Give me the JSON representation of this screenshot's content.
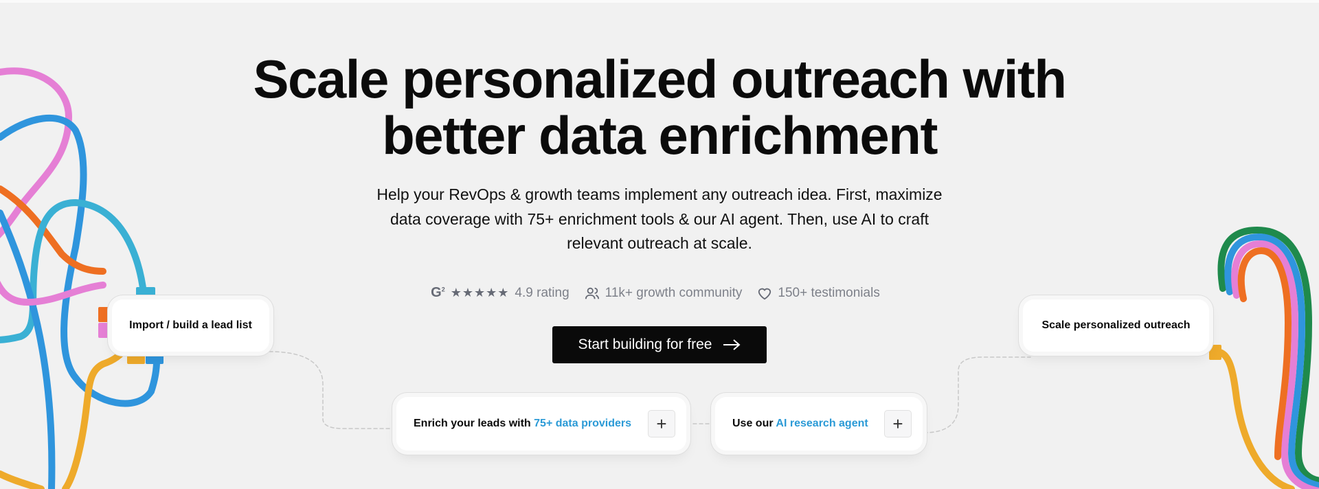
{
  "hero": {
    "title_line1": "Scale personalized outreach with",
    "title_line2": "better data enrichment",
    "subtitle_line1": "Help your RevOps & growth teams implement any outreach idea. First, maximize",
    "subtitle_line2": "data coverage with 75+ enrichment tools & our AI agent. Then, use AI to craft",
    "subtitle_line3": "relevant outreach at scale."
  },
  "stats": {
    "g2_logo": "G2",
    "stars": 5,
    "rating": "4.9 rating",
    "community": "11k+ growth community",
    "testimonials": "150+ testimonials",
    "icons": [
      "g2-logo",
      "star-icon",
      "users-icon",
      "heart-icon"
    ]
  },
  "cta": {
    "label": "Start building for free",
    "icon": "arrow-right-icon"
  },
  "flow": {
    "import": "Import / build a lead list",
    "enrich_prefix": "Enrich your leads with ",
    "enrich_highlight": "75+ data providers",
    "agent_prefix": "Use our ",
    "agent_highlight": "AI research agent",
    "scale": "Scale personalized outreach",
    "plus": "+"
  },
  "colors": {
    "accent": "#2b9ad6",
    "cta_bg": "#0a0a0a",
    "background": "#f1f1f1"
  }
}
